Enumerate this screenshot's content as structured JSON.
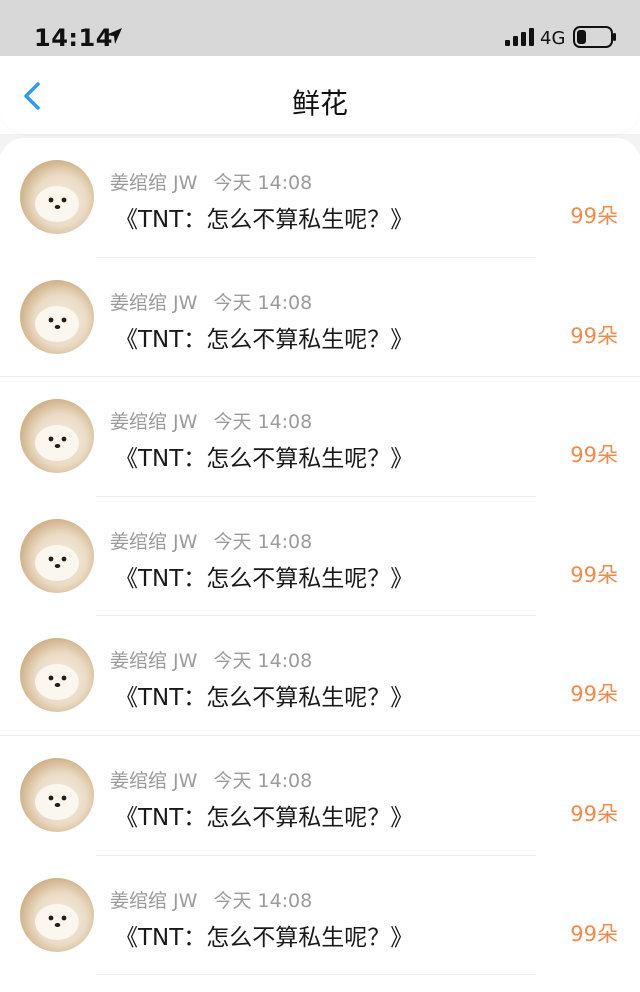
{
  "status_bar": {
    "time": "14:14",
    "network": "4G",
    "icons": [
      "location-arrow-icon",
      "signal-bars-icon",
      "battery-icon"
    ]
  },
  "nav": {
    "back_icon": "chevron-left-icon",
    "title": "鲜花"
  },
  "colors": {
    "accent_blue": "#2f9bea",
    "flower_count": "#f08a4b",
    "meta_gray": "#9b9b9b"
  },
  "items": [
    {
      "name": "姜绾绾 JW",
      "time": "今天 14:08",
      "message": "《TNT：怎么不算私生呢？》",
      "count": "99朵"
    },
    {
      "name": "姜绾绾 JW",
      "time": "今天 14:08",
      "message": "《TNT：怎么不算私生呢？》",
      "count": "99朵"
    },
    {
      "name": "姜绾绾 JW",
      "time": "今天 14:08",
      "message": "《TNT：怎么不算私生呢？》",
      "count": "99朵"
    },
    {
      "name": "姜绾绾 JW",
      "time": "今天 14:08",
      "message": "《TNT：怎么不算私生呢？》",
      "count": "99朵"
    },
    {
      "name": "姜绾绾 JW",
      "time": "今天 14:08",
      "message": "《TNT：怎么不算私生呢？》",
      "count": "99朵"
    },
    {
      "name": "姜绾绾 JW",
      "time": "今天 14:08",
      "message": "《TNT：怎么不算私生呢？》",
      "count": "99朵"
    },
    {
      "name": "姜绾绾 JW",
      "time": "今天 14:08",
      "message": "《TNT：怎么不算私生呢？》",
      "count": "99朵"
    }
  ]
}
